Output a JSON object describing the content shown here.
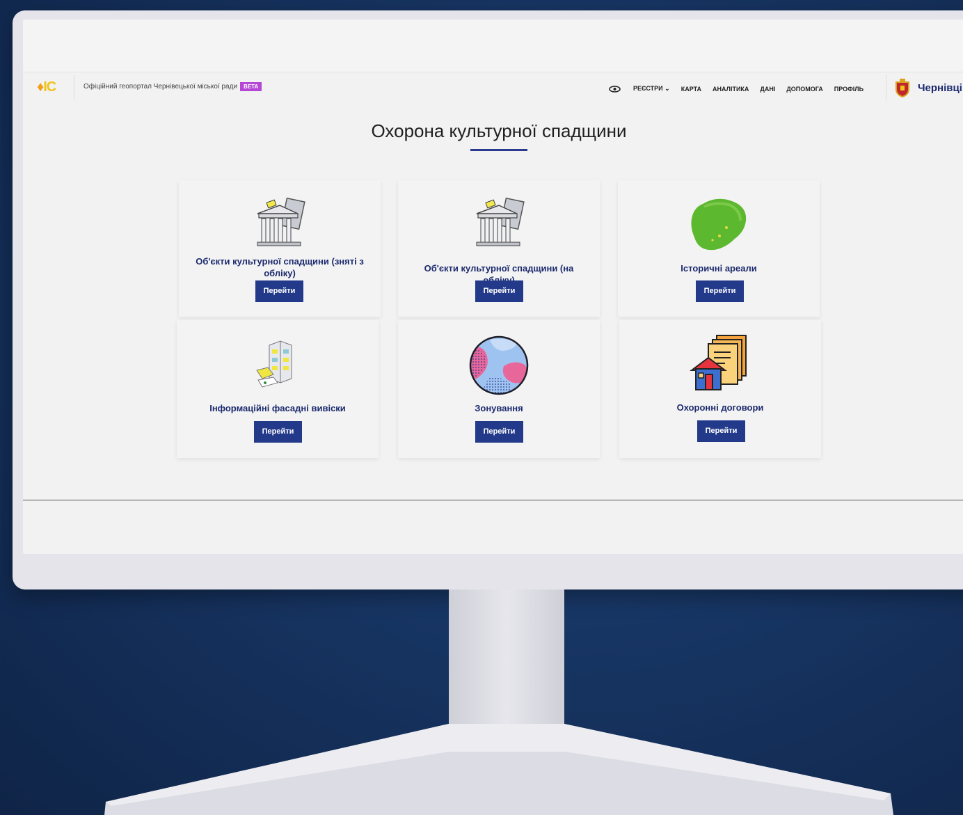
{
  "header": {
    "logo_text": "ІС",
    "portal_title": "Офіційний геопортал Чернівецької міської ради",
    "beta_label": "BETA",
    "nav": [
      {
        "label": "РЕЄСТРИ"
      },
      {
        "label": "КАРТА"
      },
      {
        "label": "АНАЛІТИКА"
      },
      {
        "label": "ДАНІ"
      },
      {
        "label": "ДОПОМОГА"
      },
      {
        "label": "ПРОФІЛЬ"
      }
    ],
    "city_name": "Чернівці"
  },
  "page": {
    "title": "Охорона культурної спадщини"
  },
  "cards": [
    {
      "label": "Об'єкти культурної спадщини (зняті з обліку)",
      "button": "Перейти",
      "icon": "heritage-building-icon"
    },
    {
      "label": "Об'єкти культурної спадщини (на обліку)",
      "button": "Перейти",
      "icon": "heritage-building-icon"
    },
    {
      "label": "Історичні ареали",
      "button": "Перейти",
      "icon": "green-area-icon"
    },
    {
      "label": "Інформаційні фасадні вивіски",
      "button": "Перейти",
      "icon": "facade-signs-icon"
    },
    {
      "label": "Зонування",
      "button": "Перейти",
      "icon": "zoning-globe-icon"
    },
    {
      "label": "Охоронні договори",
      "button": "Перейти",
      "icon": "contract-house-icon"
    }
  ],
  "colors": {
    "accent": "#233a8b",
    "heading": "#1c2a6d",
    "beta": "#b547d6",
    "logo": "#f0c419"
  }
}
